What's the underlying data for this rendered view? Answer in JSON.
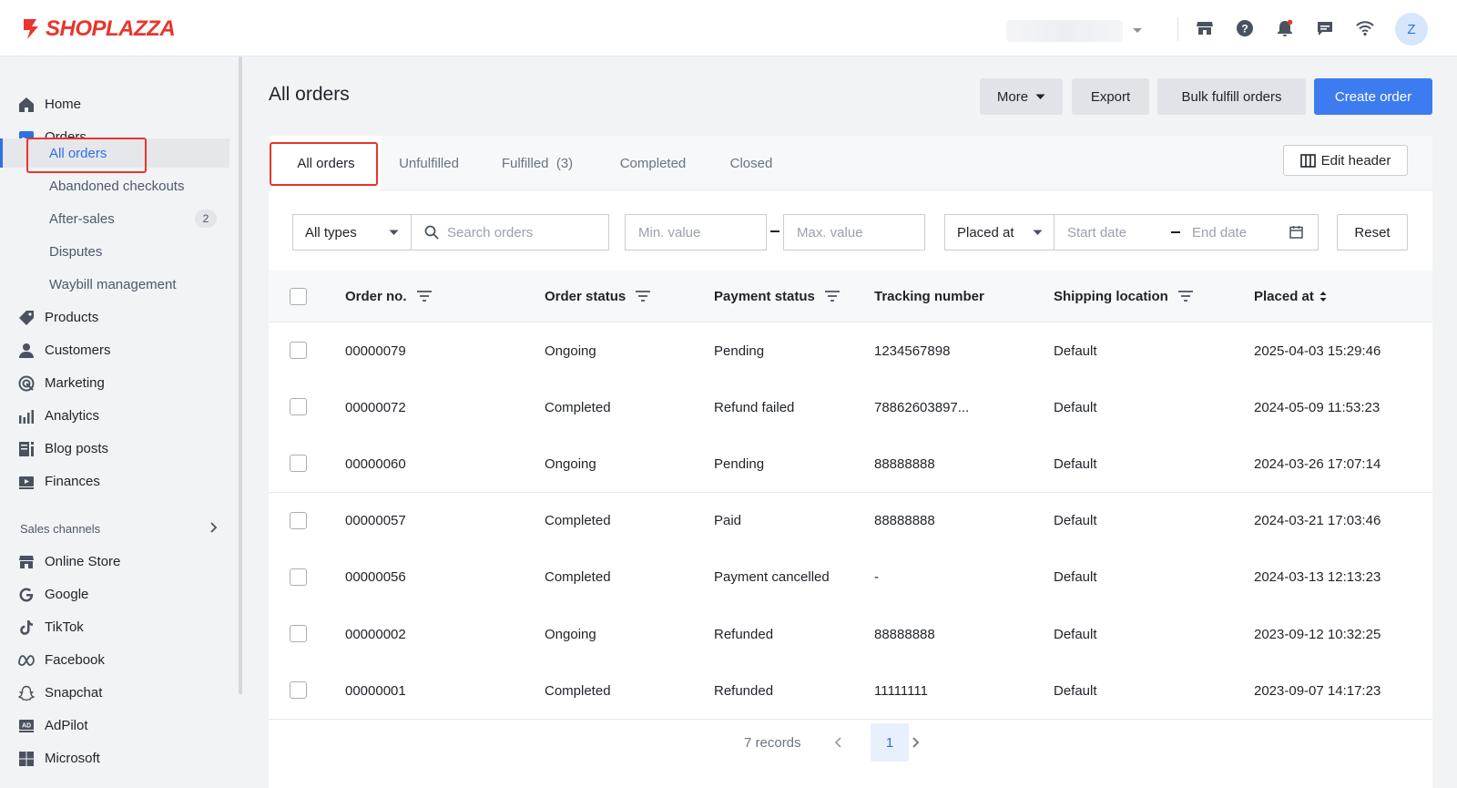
{
  "brand": {
    "name": "SHOPLAZZA",
    "color": "#e8352d",
    "accent": "#3d7cf0"
  },
  "topbar": {
    "icons": [
      "store-icon",
      "help-icon",
      "bell-icon",
      "chat-icon",
      "wifi-icon"
    ],
    "avatar_initial": "Z"
  },
  "sidebar": {
    "items": [
      {
        "label": "Home",
        "icon": "home-icon"
      },
      {
        "label": "Orders",
        "icon": "orders-icon"
      },
      {
        "label": "Products",
        "icon": "tag-icon"
      },
      {
        "label": "Customers",
        "icon": "person-icon"
      },
      {
        "label": "Marketing",
        "icon": "target-icon"
      },
      {
        "label": "Analytics",
        "icon": "bar-chart-icon"
      },
      {
        "label": "Blog posts",
        "icon": "blog-icon"
      },
      {
        "label": "Finances",
        "icon": "finance-icon"
      }
    ],
    "order_subitems": [
      {
        "label": "All orders"
      },
      {
        "label": "Abandoned checkouts"
      },
      {
        "label": "After-sales",
        "badge": "2"
      },
      {
        "label": "Disputes"
      },
      {
        "label": "Waybill management"
      }
    ],
    "sales_channels_label": "Sales channels",
    "channels": [
      {
        "label": "Online Store",
        "icon": "store-icon"
      },
      {
        "label": "Google",
        "icon": "google-icon"
      },
      {
        "label": "TikTok",
        "icon": "tiktok-icon"
      },
      {
        "label": "Facebook",
        "icon": "meta-icon"
      },
      {
        "label": "Snapchat",
        "icon": "snapchat-icon"
      },
      {
        "label": "AdPilot",
        "icon": "adpilot-icon"
      },
      {
        "label": "Microsoft",
        "icon": "microsoft-icon"
      }
    ]
  },
  "page": {
    "title": "All orders",
    "actions": {
      "more": "More",
      "export": "Export",
      "bulk": "Bulk fulfill orders",
      "create": "Create order"
    }
  },
  "tabs": [
    "All orders",
    "Unfulfilled",
    "Fulfilled  (3)",
    "Completed",
    "Closed"
  ],
  "edit_header_label": "Edit header",
  "filters": {
    "type": "All types",
    "search_placeholder": "Search orders",
    "min_placeholder": "Min. value",
    "max_placeholder": "Max. value",
    "date_field": "Placed at",
    "start_placeholder": "Start date",
    "end_placeholder": "End date",
    "reset": "Reset"
  },
  "table": {
    "columns": [
      "Order no.",
      "Order status",
      "Payment status",
      "Tracking number",
      "Shipping location",
      "Placed at"
    ],
    "rows": [
      [
        "00000079",
        "Ongoing",
        "Pending",
        "1234567898",
        "Default",
        "2025-04-03 15:29:46"
      ],
      [
        "00000072",
        "Completed",
        "Refund failed",
        "78862603897...",
        "Default",
        "2024-05-09 11:53:23"
      ],
      [
        "00000060",
        "Ongoing",
        "Pending",
        "88888888",
        "Default",
        "2024-03-26 17:07:14"
      ],
      [
        "00000057",
        "Completed",
        "Paid",
        "88888888",
        "Default",
        "2024-03-21 17:03:46"
      ],
      [
        "00000056",
        "Completed",
        "Payment cancelled",
        "-",
        "Default",
        "2024-03-13 12:13:23"
      ],
      [
        "00000002",
        "Ongoing",
        "Refunded",
        "88888888",
        "Default",
        "2023-09-12 10:32:25"
      ],
      [
        "00000001",
        "Completed",
        "Refunded",
        "11111111",
        "Default",
        "2023-09-07 14:17:23"
      ]
    ]
  },
  "pagination": {
    "records": "7 records",
    "current_page": "1"
  }
}
